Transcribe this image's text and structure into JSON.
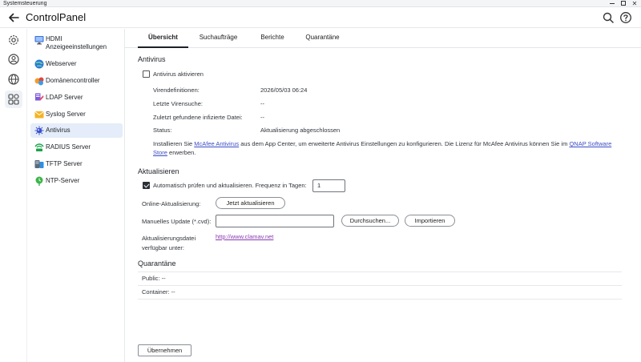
{
  "window": {
    "title": "Systemsteuerung"
  },
  "app": {
    "title": "ControlPanel"
  },
  "sidebar": {
    "items": [
      {
        "label": "HDMI Anzeigeeinstellungen",
        "icon": "monitor-icon"
      },
      {
        "label": "Webserver",
        "icon": "globe-icon"
      },
      {
        "label": "Domänencontroller",
        "icon": "domain-icon"
      },
      {
        "label": "LDAP Server",
        "icon": "ldap-icon"
      },
      {
        "label": "Syslog Server",
        "icon": "envelope-icon"
      },
      {
        "label": "Antivirus",
        "icon": "virus-icon"
      },
      {
        "label": "RADIUS Server",
        "icon": "radius-icon"
      },
      {
        "label": "TFTP Server",
        "icon": "tftp-icon"
      },
      {
        "label": "NTP-Server",
        "icon": "ntp-icon"
      }
    ],
    "active": "Antivirus"
  },
  "tabs": [
    {
      "label": "Übersicht",
      "active": true
    },
    {
      "label": "Suchaufträge",
      "active": false
    },
    {
      "label": "Berichte",
      "active": false
    },
    {
      "label": "Quarantäne",
      "active": false
    }
  ],
  "antivirus": {
    "title": "Antivirus",
    "enable_label": "Antivirus aktivieren",
    "enabled": false,
    "rows": [
      {
        "label": "Virendefinitionen:",
        "value": "2026/05/03 06:24"
      },
      {
        "label": "Letzte Virensuche:",
        "value": "--"
      },
      {
        "label": "Zuletzt gefundene infizierte Datei:",
        "value": "--"
      },
      {
        "label": "Status:",
        "value": "Aktualisierung abgeschlossen"
      }
    ],
    "info_pre": "Installieren Sie ",
    "info_link1": "McAfee Antivirus",
    "info_mid": " aus dem App Center, um erweiterte Antivirus Einstellungen zu konfigurieren. Die Lizenz für McAfee Antivirus können Sie im ",
    "info_link2a": "QNAP Software",
    "info_link2b": "Store",
    "info_post": " erwerben."
  },
  "update": {
    "title": "Aktualisieren",
    "auto_label": "Automatisch prüfen und aktualisieren. Frequenz in Tagen:",
    "auto_checked": true,
    "frequency": "1",
    "online_label": "Online-Aktualisierung:",
    "online_button": "Jetzt aktualisieren",
    "manual_label": "Manuelles Update (*.cvd):",
    "manual_value": "",
    "browse_button": "Durchsuchen...",
    "import_button": "Importieren",
    "source_label_1": "Aktualisierungsdatei",
    "source_label_2": "verfügbar unter:",
    "source_link": "http://www.clamav.net"
  },
  "quarantine": {
    "title": "Quarantäne",
    "public_label": "Public: --",
    "container_label": "Container: --"
  },
  "footer": {
    "apply_button": "Übernehmen"
  },
  "colors": {
    "accent": "#e4edf9",
    "link": "#3b4cc6",
    "visited_link": "#8a3bb0"
  }
}
